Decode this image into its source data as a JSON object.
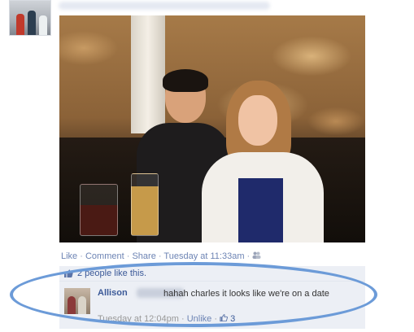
{
  "post": {
    "actions": {
      "like": "Like",
      "comment": "Comment",
      "share": "Share",
      "sep": "·",
      "timestamp": "Tuesday at 11:33am",
      "privacy_icon": "friends-icon"
    }
  },
  "likes": {
    "count_text": "2 people",
    "suffix": "like this.",
    "icon": "thumbs-up-icon"
  },
  "comment": {
    "author": "Allison",
    "text": "hahah charles it looks like we're on a date",
    "timestamp": "Tuesday at 12:04pm",
    "unlike": "Unlike",
    "like_count": "3",
    "like_icon": "thumbs-up-icon"
  },
  "colors": {
    "link_blue": "#3b5998",
    "highlight_oval": "#6c9bd8",
    "comment_bg": "#eceff5"
  }
}
